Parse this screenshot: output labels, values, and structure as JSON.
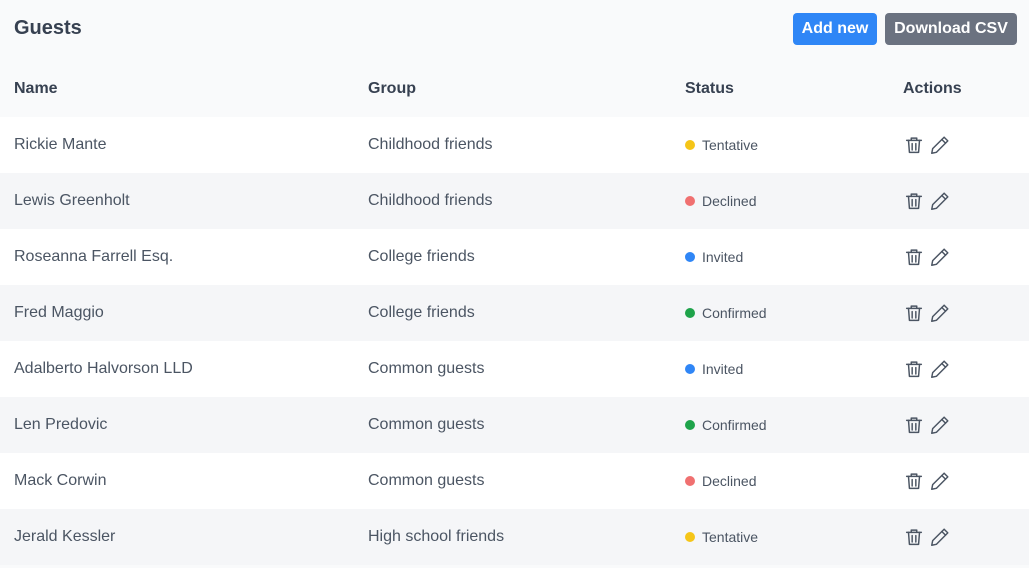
{
  "header": {
    "title": "Guests",
    "add_label": "Add new",
    "download_label": "Download CSV"
  },
  "table": {
    "columns": [
      "Name",
      "Group",
      "Status",
      "Actions"
    ],
    "rows": [
      {
        "name": "Rickie Mante",
        "group": "Childhood friends",
        "status": "Tentative",
        "status_color": "#f5c518"
      },
      {
        "name": "Lewis Greenholt",
        "group": "Childhood friends",
        "status": "Declined",
        "status_color": "#f07070"
      },
      {
        "name": "Roseanna Farrell Esq.",
        "group": "College friends",
        "status": "Invited",
        "status_color": "#2f86f6"
      },
      {
        "name": "Fred Maggio",
        "group": "College friends",
        "status": "Confirmed",
        "status_color": "#1ea34a"
      },
      {
        "name": "Adalberto Halvorson LLD",
        "group": "Common guests",
        "status": "Invited",
        "status_color": "#2f86f6"
      },
      {
        "name": "Len Predovic",
        "group": "Common guests",
        "status": "Confirmed",
        "status_color": "#1ea34a"
      },
      {
        "name": "Mack Corwin",
        "group": "Common guests",
        "status": "Declined",
        "status_color": "#f07070"
      },
      {
        "name": "Jerald Kessler",
        "group": "High school friends",
        "status": "Tentative",
        "status_color": "#f5c518"
      }
    ]
  },
  "icons": {
    "delete": "trash-icon",
    "edit": "pencil-icon"
  },
  "colors": {
    "primary": "#2f86f6",
    "secondary": "#6b7280",
    "background": "#f9fafb"
  }
}
